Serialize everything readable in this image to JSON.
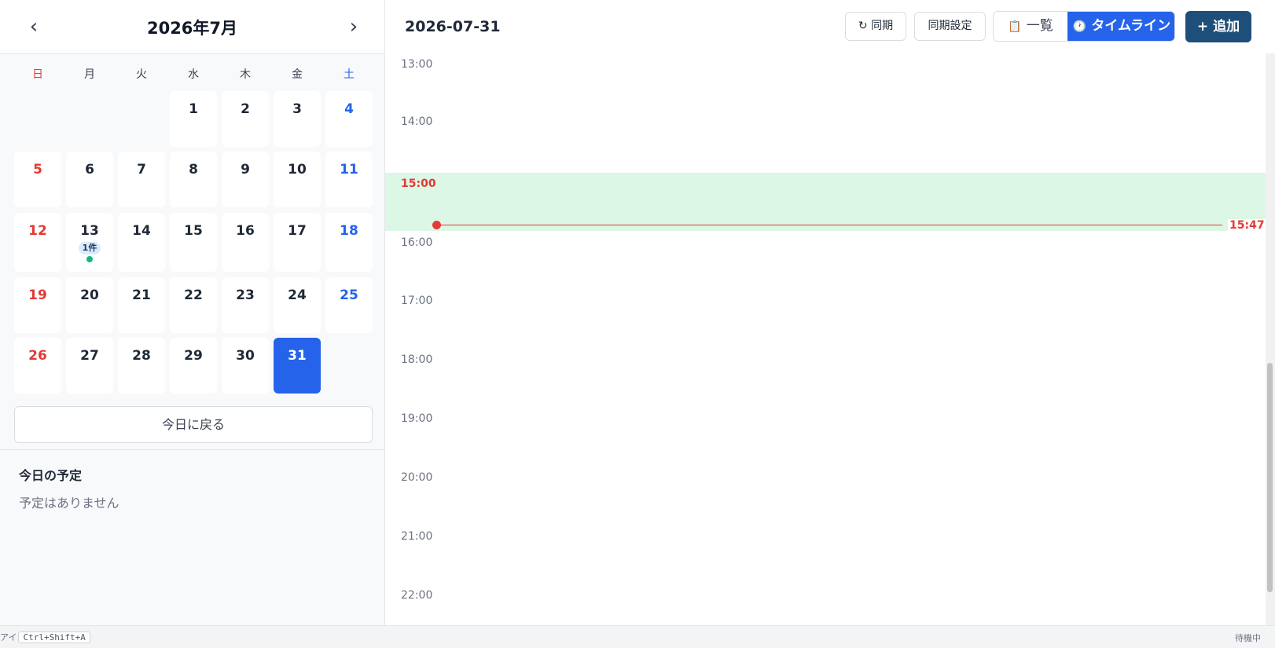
{
  "calendar": {
    "prev_label": "‹",
    "next_label": "›",
    "month_title": "2026年7月",
    "weekdays": [
      "日",
      "月",
      "火",
      "水",
      "木",
      "金",
      "土"
    ],
    "days": [
      "1",
      "2",
      "3",
      "4",
      "5",
      "6",
      "7",
      "8",
      "9",
      "10",
      "11",
      "12",
      "13",
      "14",
      "15",
      "16",
      "17",
      "18",
      "19",
      "20",
      "21",
      "22",
      "23",
      "24",
      "25",
      "26",
      "27",
      "28",
      "29",
      "30",
      "31"
    ],
    "day13_badge": "1件",
    "selected_day": "31",
    "today_button": "今日に戻る"
  },
  "today_panel": {
    "title": "今日の予定",
    "empty": "予定はありません"
  },
  "header": {
    "date": "2026-07-31",
    "sync_label": "↻ 同期",
    "sync_settings_label": "同期設定",
    "view_list_icon": "📋",
    "view_list_label": "一覧",
    "view_timeline_icon": "🕐",
    "view_timeline_label": "タイムライン",
    "add_label": "+ 追加"
  },
  "timeline": {
    "hours": [
      "13:00",
      "14:00",
      "15:00",
      "16:00",
      "17:00",
      "18:00",
      "19:00",
      "20:00",
      "21:00",
      "22:00"
    ],
    "current_hour": "15:00",
    "now_label": "15:47"
  },
  "statusbar": {
    "left_text": "アイ",
    "shortcut": "Ctrl+Shift+A",
    "right_text": "待機中"
  },
  "colors": {
    "accent": "#2563eb",
    "sunday": "#e53935",
    "saturday": "#2563eb",
    "now_line": "#e53935",
    "current_band": "#dcf7e6",
    "add_button": "#1e4f7a"
  }
}
